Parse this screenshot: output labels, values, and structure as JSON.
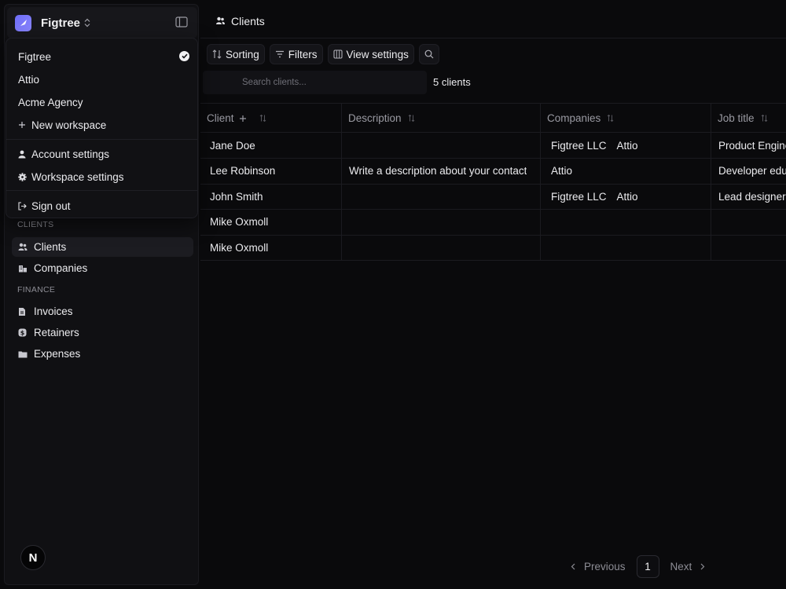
{
  "workspace": {
    "current": "Figtree"
  },
  "menu": {
    "workspaces": [
      "Figtree",
      "Attio",
      "Acme Agency"
    ],
    "new_workspace": "New workspace",
    "account_settings": "Account settings",
    "workspace_settings": "Workspace settings",
    "sign_out": "Sign out"
  },
  "nav": {
    "clients_section": "CLIENTS",
    "clients": "Clients",
    "companies": "Companies",
    "finance_section": "FINANCE",
    "invoices": "Invoices",
    "retainers": "Retainers",
    "expenses": "Expenses"
  },
  "user": {
    "avatar_letter": "N"
  },
  "page": {
    "title": "Clients"
  },
  "toolbar": {
    "sorting": "Sorting",
    "filters": "Filters",
    "view_settings": "View settings"
  },
  "search": {
    "placeholder": "Search clients...",
    "count": "5 clients"
  },
  "table": {
    "headers": [
      "Client",
      "Description",
      "Companies",
      "Job title"
    ],
    "rows": [
      {
        "client": "Jane Doe",
        "description": "",
        "companies": [
          "Figtree LLC",
          "Attio"
        ],
        "job_title": "Product Engineer"
      },
      {
        "client": "Lee Robinson",
        "description": "Write a description about your contact",
        "companies": [
          "Attio"
        ],
        "job_title": "Developer educator"
      },
      {
        "client": "John Smith",
        "description": "",
        "companies": [
          "Figtree LLC",
          "Attio"
        ],
        "job_title": "Lead designer"
      },
      {
        "client": "Mike Oxmoll",
        "description": "",
        "companies": [],
        "job_title": ""
      },
      {
        "client": "Mike Oxmoll",
        "description": "",
        "companies": [],
        "job_title": ""
      }
    ]
  },
  "pagination": {
    "previous": "Previous",
    "page": "1",
    "next": "Next"
  }
}
